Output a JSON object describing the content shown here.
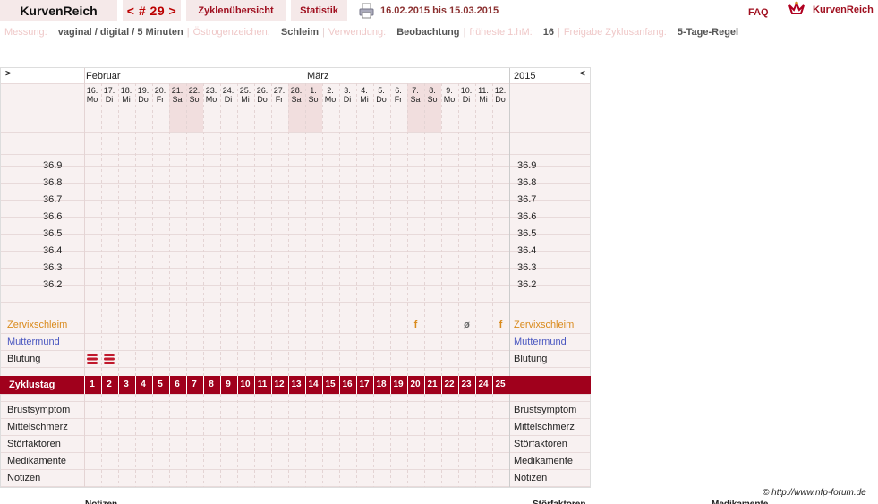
{
  "header": {
    "brand": "KurvenReich",
    "cycle": "< # 29 >",
    "overview": "Zyklenübersicht",
    "stats": "Statistik",
    "date_range": "16.02.2015 bis 15.03.2015",
    "faq": "FAQ",
    "logo_text": "KurvenReich"
  },
  "meta": [
    {
      "key": "Messung:",
      "value": "vaginal / digital / 5 Minuten"
    },
    {
      "key": "Östrogenzeichen:",
      "value": "Schleim"
    },
    {
      "key": "Verwendung:",
      "value": "Beobachtung"
    },
    {
      "key": "früheste 1.hM:",
      "value": "16"
    },
    {
      "key": "Freigabe Zyklusanfang:",
      "value": "5-Tage-Regel"
    }
  ],
  "chart": {
    "nav_prev": ">",
    "nav_next": "<",
    "month1": "Februar",
    "month2": "März",
    "year": "2015",
    "days": [
      {
        "d": "16.",
        "w": "Mo"
      },
      {
        "d": "17.",
        "w": "Di"
      },
      {
        "d": "18.",
        "w": "Mi"
      },
      {
        "d": "19.",
        "w": "Do"
      },
      {
        "d": "20.",
        "w": "Fr"
      },
      {
        "d": "21.",
        "w": "Sa"
      },
      {
        "d": "22.",
        "w": "So"
      },
      {
        "d": "23.",
        "w": "Mo"
      },
      {
        "d": "24.",
        "w": "Di"
      },
      {
        "d": "25.",
        "w": "Mi"
      },
      {
        "d": "26.",
        "w": "Do"
      },
      {
        "d": "27.",
        "w": "Fr"
      },
      {
        "d": "28.",
        "w": "Sa"
      },
      {
        "d": "1.",
        "w": "So"
      },
      {
        "d": "2.",
        "w": "Mo"
      },
      {
        "d": "3.",
        "w": "Di"
      },
      {
        "d": "4.",
        "w": "Mi"
      },
      {
        "d": "5.",
        "w": "Do"
      },
      {
        "d": "6.",
        "w": "Fr"
      },
      {
        "d": "7.",
        "w": "Sa"
      },
      {
        "d": "8.",
        "w": "So"
      },
      {
        "d": "9.",
        "w": "Mo"
      },
      {
        "d": "10.",
        "w": "Di"
      },
      {
        "d": "11.",
        "w": "Mi"
      },
      {
        "d": "12.",
        "w": "Do"
      }
    ],
    "weekend_days": [
      6,
      7,
      13,
      14,
      20,
      21
    ],
    "temps": [
      "36.9",
      "36.8",
      "36.7",
      "36.6",
      "36.5",
      "36.4",
      "36.3",
      "36.2"
    ],
    "cervix_label": "Zervixschleim",
    "cervix_marks": [
      {
        "day": 20,
        "sym": "f"
      },
      {
        "day": 23,
        "sym": "ø"
      },
      {
        "day": 25,
        "sym": "f"
      }
    ],
    "os_label": "Muttermund",
    "bleeding_label": "Blutung",
    "bleeding_days": [
      1,
      2
    ],
    "cycle_label": "Zyklustag",
    "cycle_days": [
      "1",
      "2",
      "3",
      "4",
      "5",
      "6",
      "7",
      "8",
      "9",
      "10",
      "11",
      "12",
      "13",
      "14",
      "15",
      "16",
      "17",
      "18",
      "19",
      "20",
      "21",
      "22",
      "23",
      "24",
      "25"
    ],
    "rows": [
      "Brustsymptom",
      "Mittelschmerz",
      "Störfaktoren",
      "Medikamente",
      "Notizen"
    ]
  },
  "footer": {
    "credit": "© http://www.nfp-forum.de",
    "cut_labels": [
      "Notizen",
      "Störfaktoren",
      "Medikamente"
    ]
  },
  "colors": {
    "accent": "#a0001c",
    "cervix": "#d98a1c",
    "os": "#4a57c0",
    "bleeding": "#c0182c",
    "weekend": "#f1dede",
    "panel": "#f8f1f1"
  }
}
